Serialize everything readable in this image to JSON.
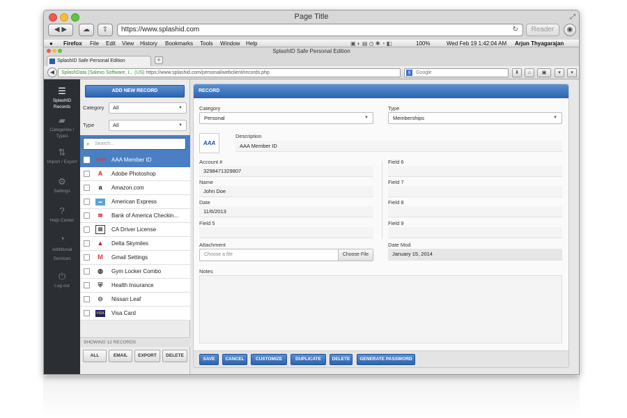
{
  "safari": {
    "title": "Page Title",
    "url": "https://www.splashid.com",
    "reader_label": "Reader"
  },
  "menubar": {
    "app": "Firefox",
    "items": [
      "File",
      "Edit",
      "View",
      "History",
      "Bookmarks",
      "Tools",
      "Window",
      "Help"
    ],
    "battery": "100%",
    "datetime": "Wed Feb 19  1:42:04 AM",
    "user": "Arjun Thyagarajan"
  },
  "firefox": {
    "window_title": "SplashID Safe Personal Edition",
    "tab_label": "SplashID Safe Personal Edition",
    "identity": "SplashData (Salexo Software, I... (US)",
    "url": "https://www.splashid.com/personal/webclient/records.php",
    "search_placeholder": "Google"
  },
  "leftnav": [
    {
      "label": "SplashID Records",
      "icon": "list-icon",
      "active": true
    },
    {
      "label": "Categories / Types",
      "icon": "folder-icon",
      "active": false
    },
    {
      "label": "Import / Export",
      "icon": "import-export-icon",
      "active": false
    },
    {
      "label": "Settings",
      "icon": "gear-icon",
      "active": false
    },
    {
      "label": "Help Center",
      "icon": "help-icon",
      "active": false
    },
    {
      "label": "Additional Services",
      "icon": "additional-services-icon",
      "active": false
    },
    {
      "label": "Log out",
      "icon": "power-icon",
      "active": false
    }
  ],
  "listpane": {
    "add_button": "ADD NEW RECORD",
    "category_label": "Category",
    "category_value": "All",
    "type_label": "Type",
    "type_value": "All",
    "search_placeholder": "Search...",
    "records": [
      {
        "label": "AAA Member ID",
        "icon": "aaa-logo-icon",
        "selected": true
      },
      {
        "label": "Adobe Photoshop",
        "icon": "adobe-logo-icon",
        "selected": false
      },
      {
        "label": "Amazon.com",
        "icon": "amazon-logo-icon",
        "selected": false
      },
      {
        "label": "American Express",
        "icon": "amex-logo-icon",
        "selected": false
      },
      {
        "label": "Bank of America Checkin...",
        "icon": "boa-logo-icon",
        "selected": false
      },
      {
        "label": "CA Driver License",
        "icon": "id-card-icon",
        "selected": false
      },
      {
        "label": "Delta Skymiles",
        "icon": "delta-logo-icon",
        "selected": false
      },
      {
        "label": "Gmail Settings",
        "icon": "gmail-logo-icon",
        "selected": false
      },
      {
        "label": "Gym Locker Combo",
        "icon": "lock-icon",
        "selected": false
      },
      {
        "label": "Health Insurance",
        "icon": "health-shield-icon",
        "selected": false
      },
      {
        "label": "Nissan Leaf",
        "icon": "nissan-logo-icon",
        "selected": false
      },
      {
        "label": "Visa Card",
        "icon": "visa-logo-icon",
        "selected": false
      }
    ],
    "showing": "SHOWING 12 RECORDS",
    "buttons": [
      "ALL",
      "EMAIL",
      "EXPORT",
      "DELETE"
    ]
  },
  "record": {
    "header": "RECORD",
    "category_label": "Category",
    "category_value": "Personal",
    "type_label": "Type",
    "type_value": "Memberships",
    "description_label": "Description",
    "description_value": "AAA Member ID",
    "logo_text": "AAA",
    "fields_left": [
      {
        "label": "Account #",
        "value": "3298471329807"
      },
      {
        "label": "Name",
        "value": "John Doe"
      },
      {
        "label": "Date",
        "value": "11/6/2013"
      },
      {
        "label": "Field 5",
        "value": ""
      }
    ],
    "fields_right": [
      {
        "label": "Field 6",
        "value": ""
      },
      {
        "label": "Field 7",
        "value": ""
      },
      {
        "label": "Field 8",
        "value": ""
      },
      {
        "label": "Field 9",
        "value": ""
      }
    ],
    "attachment_label": "Attachment",
    "attachment_placeholder": "Choose a file",
    "choose_file_label": "Choose File",
    "datemod_label": "Date Mod",
    "datemod_value": "January 15, 2014",
    "notes_label": "Notes",
    "actions": [
      "SAVE",
      "CANCEL",
      "CUSTOMIZE",
      "DUPLICATE",
      "DELETE",
      "GENERATE PASSWORD"
    ]
  }
}
